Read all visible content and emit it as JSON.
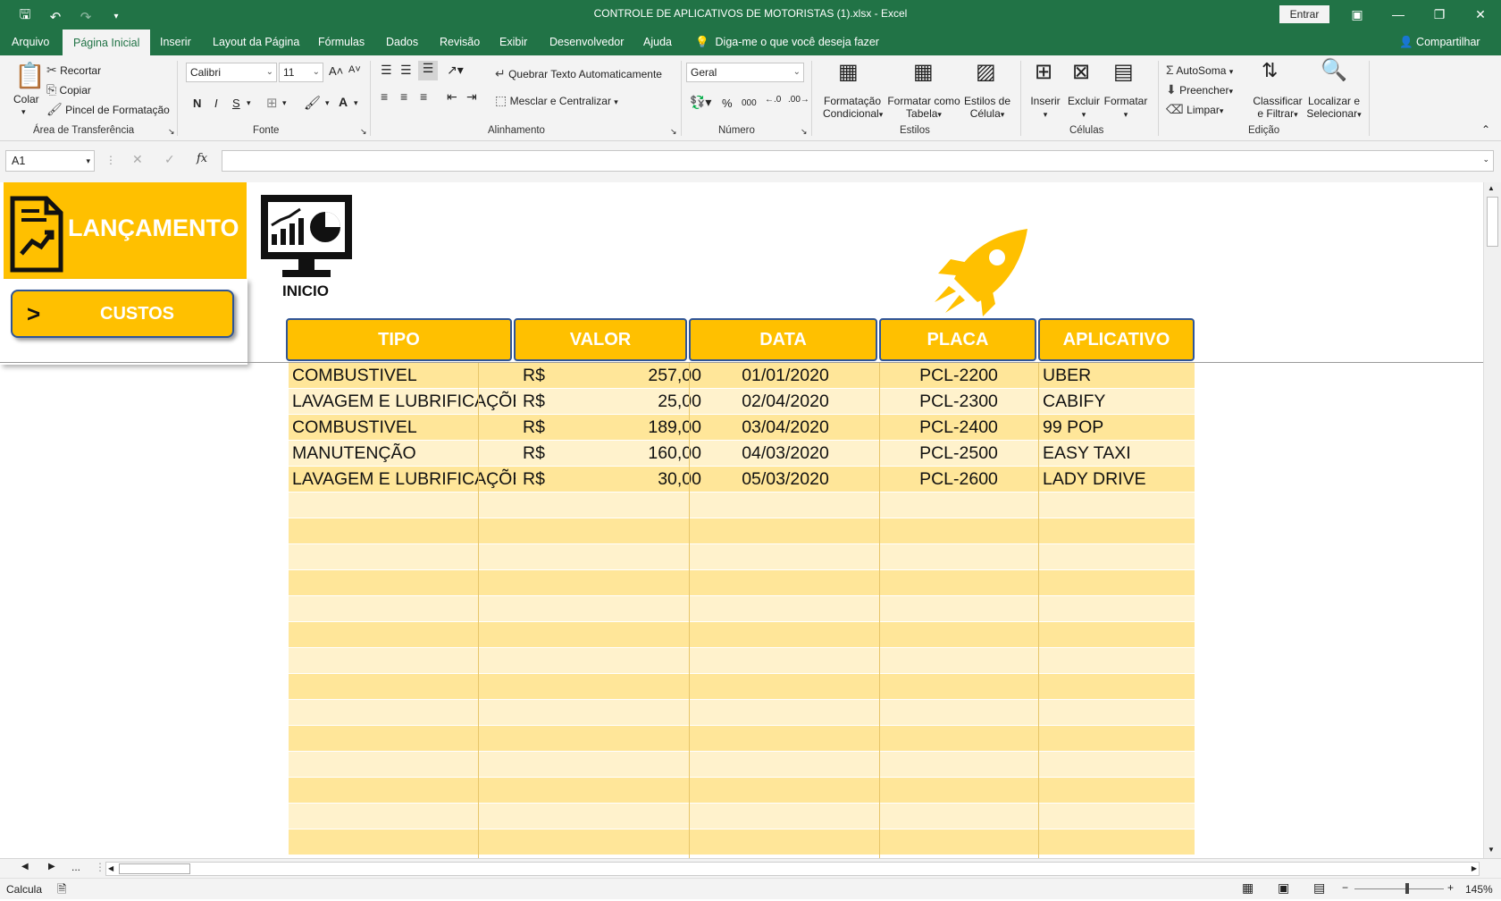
{
  "window": {
    "title": "CONTROLE DE APLICATIVOS DE MOTORISTAS (1).xlsx  -  Excel",
    "signin": "Entrar"
  },
  "menu": {
    "tabs": [
      "Arquivo",
      "Página Inicial",
      "Inserir",
      "Layout da Página",
      "Fórmulas",
      "Dados",
      "Revisão",
      "Exibir",
      "Desenvolvedor",
      "Ajuda"
    ],
    "active": "Página Inicial",
    "tell_me": "Diga-me o que você deseja fazer",
    "share": "Compartilhar"
  },
  "ribbon": {
    "clipboard": {
      "paste": "Colar",
      "cut": "Recortar",
      "copy": "Copiar",
      "format_painter": "Pincel de Formatação",
      "label": "Área de Transferência"
    },
    "font": {
      "name": "Calibri",
      "size": "11",
      "bold": "N",
      "italic": "I",
      "underline": "S",
      "color_letter": "A",
      "label": "Fonte"
    },
    "alignment": {
      "wrap": "Quebrar Texto Automaticamente",
      "merge": "Mesclar e Centralizar",
      "label": "Alinhamento"
    },
    "number": {
      "format": "Geral",
      "percent": "%",
      "thousands": "000",
      "label": "Número"
    },
    "styles": {
      "conditional": "Formatação Condicional",
      "conditional_l1": "Formatação",
      "conditional_l2": "Condicional",
      "table_l1": "Formatar como",
      "table_l2": "Tabela",
      "cell_l1": "Estilos de",
      "cell_l2": "Célula",
      "label": "Estilos"
    },
    "cells": {
      "insert": "Inserir",
      "delete": "Excluir",
      "format": "Formatar",
      "label": "Células"
    },
    "editing": {
      "autosum": "AutoSoma",
      "fill": "Preencher",
      "clear": "Limpar",
      "sort_l1": "Classificar",
      "sort_l2": "e Filtrar",
      "find_l1": "Localizar e",
      "find_l2": "Selecionar",
      "label": "Edição"
    }
  },
  "formula_bar": {
    "name_box": "A1",
    "fx": "fx",
    "value": ""
  },
  "sheet": {
    "banner": "LANÇAMENTO",
    "custos_button": "CUSTOS",
    "custos_arrow": ">",
    "inicio": "INICIO",
    "headers": [
      "TIPO",
      "VALOR",
      "DATA",
      "PLACA",
      "APLICATIVO"
    ],
    "currency": "R$",
    "rows": [
      {
        "tipo": "COMBUSTIVEL",
        "valor": "257,00",
        "data": "01/01/2020",
        "placa": "PCL-2200",
        "aplicativo": "UBER"
      },
      {
        "tipo": "LAVAGEM E LUBRIFICAÇÕES",
        "valor": "25,00",
        "data": "02/04/2020",
        "placa": "PCL-2300",
        "aplicativo": "CABIFY"
      },
      {
        "tipo": "COMBUSTIVEL",
        "valor": "189,00",
        "data": "03/04/2020",
        "placa": "PCL-2400",
        "aplicativo": "99 POP"
      },
      {
        "tipo": "MANUTENÇÃO",
        "valor": "160,00",
        "data": "04/03/2020",
        "placa": "PCL-2500",
        "aplicativo": "EASY TAXI"
      },
      {
        "tipo": "LAVAGEM E LUBRIFICAÇÕES",
        "valor": "30,00",
        "data": "05/03/2020",
        "placa": "PCL-2600",
        "aplicativo": "LADY DRIVE"
      }
    ],
    "empty_rows": 14,
    "colors": {
      "accent": "#FFC000",
      "row_dark": "#FFE699",
      "row_light": "#FFF2CC",
      "border": "#2F5597",
      "title_green": "#217346"
    }
  },
  "status": {
    "mode": "Calcula",
    "zoom": "145%",
    "zoom_minus": "−",
    "zoom_plus": "+"
  },
  "sheet_nav": {
    "ellipsis": "..."
  }
}
